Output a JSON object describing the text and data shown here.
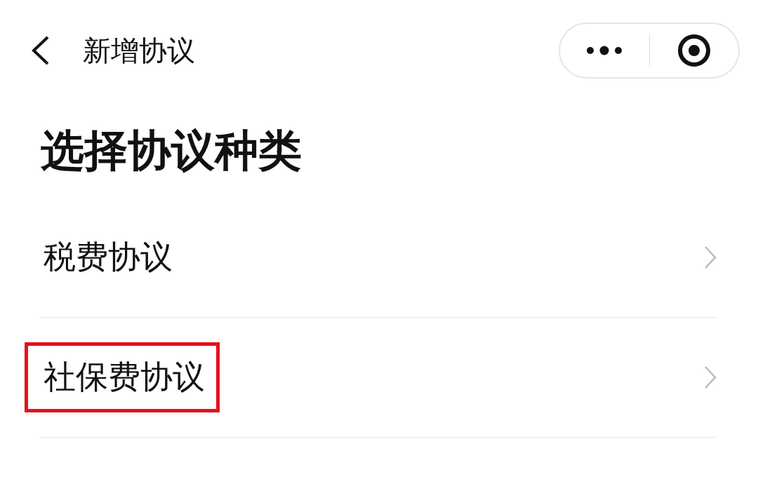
{
  "nav_bar": {
    "title": "新增协议"
  },
  "heading": "选择协议种类",
  "items": [
    {
      "label": "税费协议",
      "highlighted": false
    },
    {
      "label": "社保费协议",
      "highlighted": true
    }
  ]
}
